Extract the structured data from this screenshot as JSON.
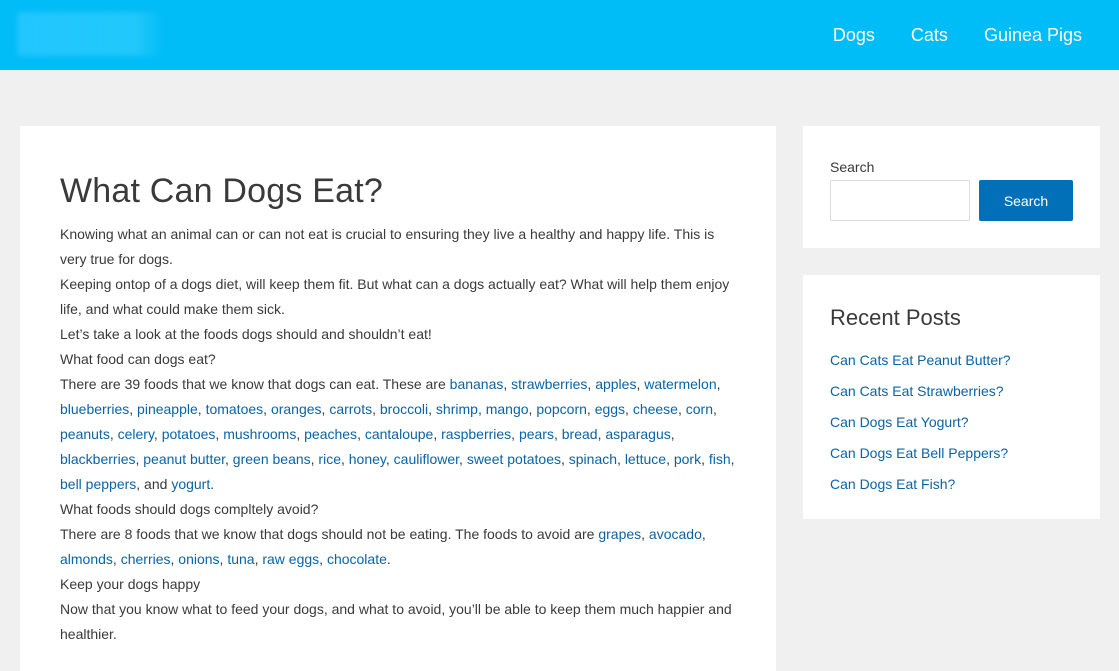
{
  "nav": {
    "items": [
      "Dogs",
      "Cats",
      "Guinea Pigs"
    ]
  },
  "article": {
    "title": "What Can Dogs Eat?",
    "intro1": "Knowing what an animal can or can not eat is crucial to ensuring they live a healthy and happy life. This is very true for dogs.",
    "intro2": "Keeping ontop of a dogs diet, will keep them fit. But what can a dogs actually eat? What will help them enjoy life, and what could make them sick.",
    "intro3": "Let’s take a look at the foods dogs should and shouldn’t eat!",
    "can_heading": "What food can dogs eat?",
    "can_prefix": "There are 39 foods that we know that dogs can eat. These are ",
    "can_foods": [
      "bananas",
      "strawberries",
      "apples",
      "watermelon",
      "blueberries",
      "pineapple",
      "tomatoes",
      "oranges",
      "carrots",
      "broccoli",
      "shrimp",
      "mango",
      "popcorn",
      "eggs",
      "cheese",
      "corn",
      "peanuts",
      "celery",
      "potatoes",
      "mushrooms",
      "peaches",
      "cantaloupe",
      "raspberries",
      "pears",
      "bread",
      "asparagus",
      "blackberries",
      "peanut butter",
      "green beans",
      "rice",
      "honey",
      "cauliflower",
      "sweet potatoes",
      "spinach",
      "lettuce",
      "pork",
      "fish",
      "bell peppers",
      "yogurt"
    ],
    "avoid_heading": "What foods should dogs compltely avoid?",
    "avoid_prefix": "There are 8 foods that we know that dogs should not be eating. The foods to avoid are ",
    "avoid_foods": [
      "grapes",
      "avocado",
      "almonds",
      "cherries",
      "onions",
      "tuna",
      "raw eggs",
      "chocolate"
    ],
    "happy_heading": "Keep your dogs happy",
    "outro": "Now that you know what to feed your dogs, and what to avoid, you’ll be able to keep them much happier and healthier."
  },
  "sidebar": {
    "search_label": "Search",
    "search_button": "Search",
    "search_value": "",
    "recent_title": "Recent Posts",
    "recent_posts": [
      "Can Cats Eat Peanut Butter?",
      "Can Cats Eat Strawberries?",
      "Can Dogs Eat Yogurt?",
      "Can Dogs Eat Bell Peppers?",
      "Can Dogs Eat Fish?"
    ]
  }
}
